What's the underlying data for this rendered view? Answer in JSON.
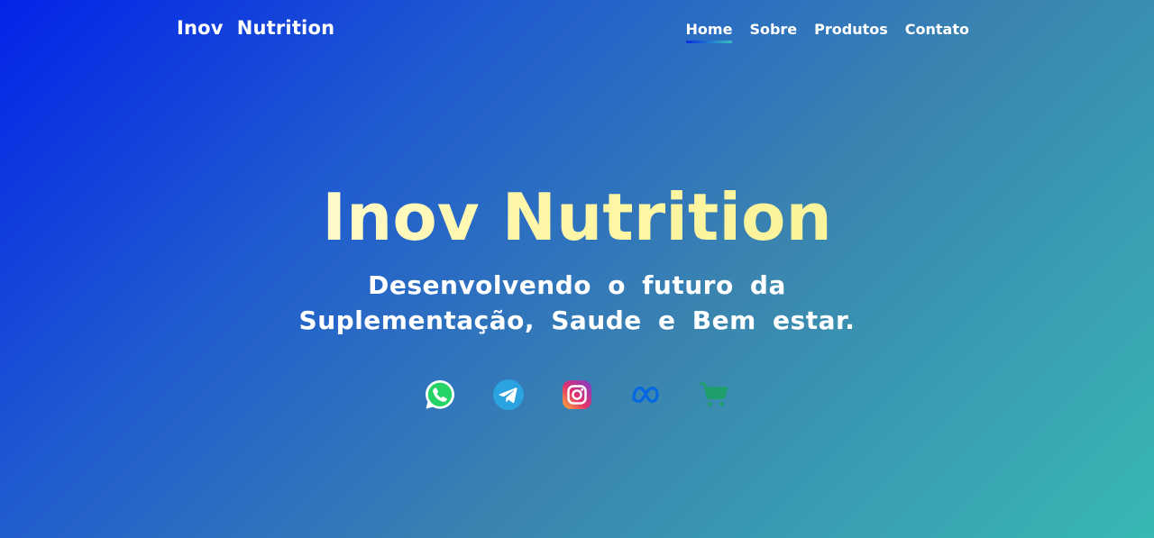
{
  "header": {
    "logo": "Inov  Nutrition",
    "nav": [
      {
        "label": "Home",
        "active": true
      },
      {
        "label": "Sobre",
        "active": false
      },
      {
        "label": "Produtos",
        "active": false
      },
      {
        "label": "Contato",
        "active": false
      }
    ]
  },
  "hero": {
    "title": "Inov Nutrition",
    "subtitle": "Desenvolvendo o futuro da\nSuplementação, Saude e Bem estar."
  },
  "socials": [
    {
      "icon": "whatsapp-icon",
      "color": "#25d366"
    },
    {
      "icon": "telegram-icon",
      "color": "#2aa3e0"
    },
    {
      "icon": "instagram-icon",
      "color": "#e1306c"
    },
    {
      "icon": "meta-icon",
      "color": "#0668e1"
    },
    {
      "icon": "shopping-cart-icon",
      "color": "#1e9e6a"
    }
  ],
  "colors": {
    "gradient_start": "#0423e8",
    "gradient_end": "#38b8b4",
    "title_highlight": "#fff7a8"
  }
}
